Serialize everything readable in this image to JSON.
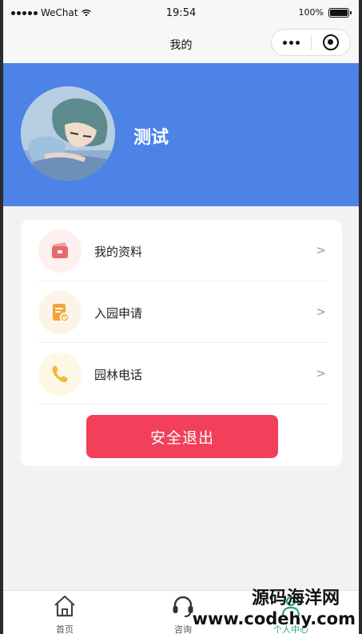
{
  "status_bar": {
    "carrier": "WeChat",
    "time": "19:54",
    "battery_text": "100%",
    "battery_level": 1.0
  },
  "nav": {
    "title": "我的"
  },
  "profile": {
    "username": "测试"
  },
  "menu": {
    "items": [
      {
        "label": "我的资料",
        "arrow": ">",
        "icon": "card-icon",
        "icon_color": "#e86a6a",
        "icon_bg": "#fdf0ee"
      },
      {
        "label": "入园申请",
        "arrow": ">",
        "icon": "document-check-icon",
        "icon_color": "#f2a33a",
        "icon_bg": "#fdf4e8"
      },
      {
        "label": "园林电话",
        "arrow": ">",
        "icon": "phone-icon",
        "icon_color": "#f5b82e",
        "icon_bg": "#fdf7e6"
      }
    ],
    "logout_label": "安全退出"
  },
  "tab_bar": {
    "tabs": [
      {
        "label": "首页",
        "icon": "home-icon"
      },
      {
        "label": "咨询",
        "icon": "headset-icon"
      },
      {
        "label": "个人中心",
        "icon": "person-icon",
        "active": true
      }
    ],
    "active_color": "#2aa876"
  },
  "colors": {
    "header_bg": "#4d82e6",
    "logout_bg": "#f2405a"
  },
  "watermark": {
    "name": "源码海洋网",
    "url": "www.codehy.com"
  }
}
